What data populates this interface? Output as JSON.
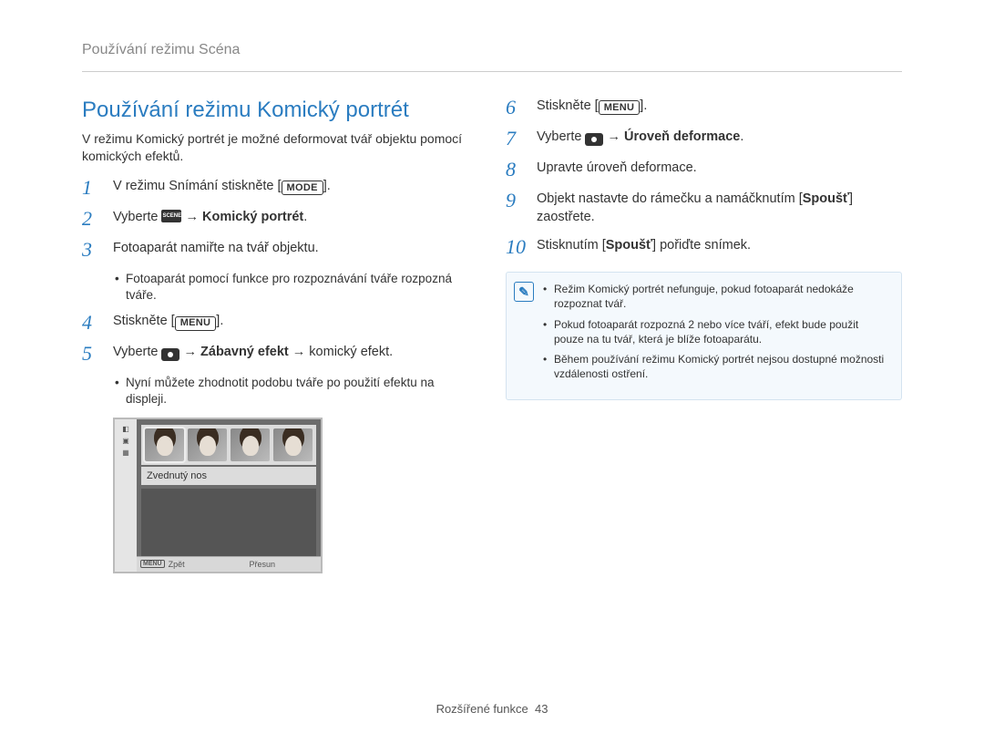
{
  "header": "Používání režimu Scéna",
  "section_title": "Používání režimu Komický portrét",
  "intro": "V režimu Komický portrét je možné deformovat tvář objektu pomocí komických efektů.",
  "tokens": {
    "mode": "MODE",
    "menu": "MENU"
  },
  "left_steps": {
    "s1_a": "V režimu Snímání stiskněte ",
    "s1_b": ".",
    "s2_a": "Vyberte ",
    "s2_b": " → ",
    "s2_c": "Komický portrét",
    "s2_d": ".",
    "s3": "Fotoaparát namiřte na tvář objektu.",
    "s3_sub": "Fotoaparát pomocí funkce pro rozpoznávání tváře rozpozná tváře.",
    "s4_a": "Stiskněte [",
    "s4_b": "].",
    "s5_a": "Vyberte ",
    "s5_b": " → ",
    "s5_c": "Zábavný efekt",
    "s5_d": " → komický efekt.",
    "s5_sub": "Nyní můžete zhodnotit podobu tváře po použití efektu na displeji."
  },
  "camshot": {
    "label": "Zvednutý nos",
    "back": "Zpět",
    "move": "Přesun",
    "menu_tag": "MENU"
  },
  "right_steps": {
    "s6_a": "Stiskněte [",
    "s6_b": "].",
    "s7_a": "Vyberte ",
    "s7_b": " → ",
    "s7_c": "Úroveň deformace",
    "s7_d": ".",
    "s8": "Upravte úroveň deformace.",
    "s9_a": "Objekt nastavte do rámečku a namáčknutím [",
    "s9_b": "Spoušť",
    "s9_c": "] zaostřete.",
    "s10_a": "Stisknutím [",
    "s10_b": "Spoušť",
    "s10_c": "] pořiďte snímek."
  },
  "notes": [
    "Režim Komický portrét nefunguje, pokud fotoaparát nedokáže rozpoznat tvář.",
    "Pokud fotoaparát rozpozná 2 nebo více tváří, efekt bude použit pouze na tu tvář, která je blíže fotoaparátu.",
    "Během používání režimu Komický portrét nejsou dostupné možnosti vzdálenosti ostření."
  ],
  "footer_a": "Rozšířené funkce",
  "footer_b": "43",
  "step_numbers": {
    "n1": "1",
    "n2": "2",
    "n3": "3",
    "n4": "4",
    "n5": "5",
    "n6": "6",
    "n7": "7",
    "n8": "8",
    "n9": "9",
    "n10": "10"
  }
}
